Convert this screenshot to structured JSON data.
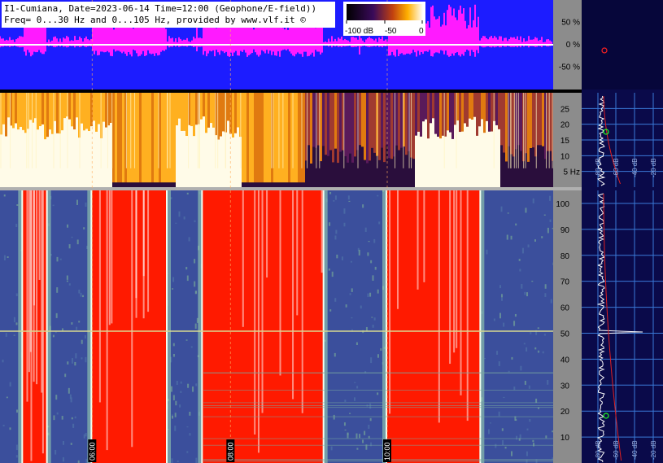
{
  "header": {
    "line1": "I1-Cumiana, Date=2023-06-14 Time=12:00 (Geophone/E-field))",
    "line2": "Freq= 0...30 Hz and 0...105 Hz, provided by www.vlf.it ©"
  },
  "colorbar": {
    "labels": [
      "-100 dB",
      "-50",
      "0"
    ]
  },
  "colors": {
    "amp_bg": "#1c1cff",
    "amp_signal": "#ff1aff",
    "axis_panel": "#8c8c8c",
    "right_bg": "#0a0a4a",
    "grid": "#3a7ad8",
    "spec_low_bg": "#3b4f9c",
    "spec_low_hot": "#ff1a00",
    "spec_up_dark": "#3a0a4a",
    "spec_up_hot": "#ffffff"
  },
  "chart_data": [
    {
      "type": "line",
      "title": "",
      "ylabel": "",
      "y_ticks": [
        "50 %",
        "0 %",
        "-50 %"
      ],
      "ylim": [
        -100,
        100
      ],
      "x_time_labels": [
        "06:00",
        "08:00",
        "10:00"
      ]
    },
    {
      "type": "heatmap",
      "ylim": [
        0,
        30
      ],
      "y_ticks": [
        25,
        20,
        15,
        10,
        "5 Hz"
      ],
      "colormap": "black-purple-orange-white",
      "hot_bands_hours": [
        [
          0.0,
          1.2
        ],
        [
          1.9,
          2.6
        ],
        [
          4.5,
          5.4
        ]
      ]
    },
    {
      "type": "heatmap",
      "ylim": [
        0,
        105
      ],
      "y_ticks": [
        100,
        90,
        80,
        70,
        60,
        50,
        40,
        30,
        20,
        10
      ],
      "colormap": "blue-green-white-red",
      "x_time_labels": [
        "06:00",
        "08:00",
        "10:00"
      ],
      "hot_bands_hours": [
        [
          0.25,
          0.5
        ],
        [
          1.0,
          1.8
        ],
        [
          2.2,
          3.5
        ],
        [
          4.2,
          5.2
        ]
      ],
      "line_50hz": true
    },
    {
      "type": "line",
      "name": "spectrum-0-30Hz",
      "x_ticks": [
        "-80 dB",
        "-60 dB",
        "-40 dB",
        "-20 dB"
      ]
    },
    {
      "type": "line",
      "name": "spectrum-0-105Hz",
      "x_ticks": [
        "-80 dB",
        "-60 dB",
        "-40 dB",
        "-20 dB"
      ]
    }
  ]
}
